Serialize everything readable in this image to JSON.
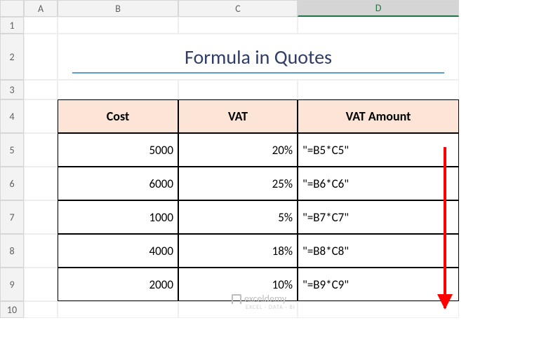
{
  "columns": [
    "A",
    "B",
    "C",
    "D"
  ],
  "rows": [
    "1",
    "2",
    "3",
    "4",
    "5",
    "6",
    "7",
    "8",
    "9",
    "10"
  ],
  "selected_col": "D",
  "title": "Formula in Quotes",
  "headers": {
    "cost": "Cost",
    "vat": "VAT",
    "amount": "VAT Amount"
  },
  "data": [
    {
      "cost": "5000",
      "vat": "20%",
      "amount": "\"=B5*C5\""
    },
    {
      "cost": "6000",
      "vat": "25%",
      "amount": "\"=B6*C6\""
    },
    {
      "cost": "1000",
      "vat": "5%",
      "amount": "\"=B7*C7\""
    },
    {
      "cost": "4000",
      "vat": "18%",
      "amount": "\"=B8*C8\""
    },
    {
      "cost": "2000",
      "vat": "10%",
      "amount": "\"=B9*C9\""
    }
  ],
  "watermark": {
    "main": "exceldemy",
    "sub": "EXCEL · DATA · BI"
  },
  "chart_data": {
    "type": "table",
    "title": "Formula in Quotes",
    "columns": [
      "Cost",
      "VAT",
      "VAT Amount"
    ],
    "rows": [
      [
        "5000",
        "20%",
        "\"=B5*C5\""
      ],
      [
        "6000",
        "25%",
        "\"=B6*C6\""
      ],
      [
        "1000",
        "5%",
        "\"=B7*C7\""
      ],
      [
        "4000",
        "18%",
        "\"=B8*C8\""
      ],
      [
        "2000",
        "10%",
        "\"=B9*C9\""
      ]
    ]
  }
}
